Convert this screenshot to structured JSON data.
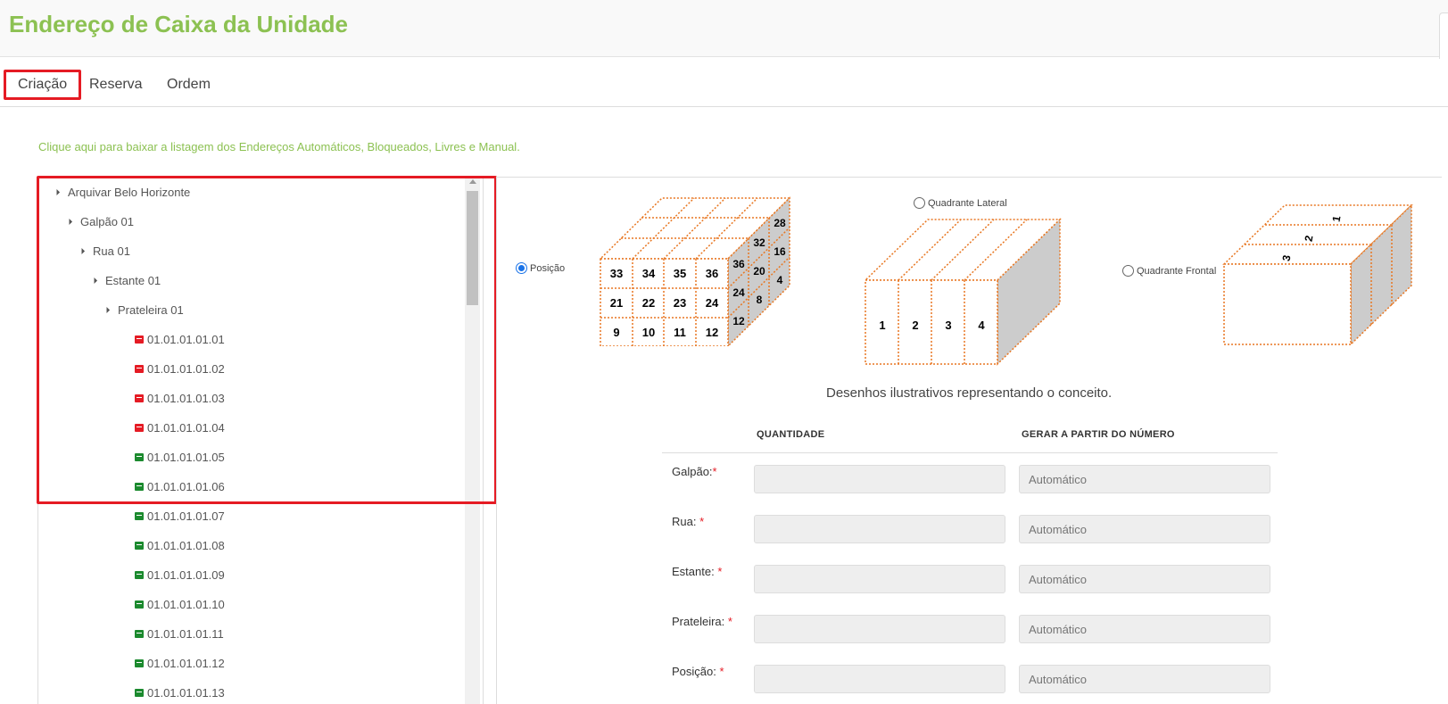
{
  "header": {
    "title": "Endereço de Caixa da Unidade"
  },
  "tabs": [
    {
      "label": "Criação",
      "active": true
    },
    {
      "label": "Reserva",
      "active": false
    },
    {
      "label": "Ordem",
      "active": false
    }
  ],
  "download_link": "Clique aqui para baixar a listagem dos Endereços Automáticos, Bloqueados, Livres e Manual.",
  "tree": {
    "nodes": [
      {
        "label": "Arquivar Belo Horizonte",
        "level": 0,
        "type": "folder"
      },
      {
        "label": "Galpão 01",
        "level": 1,
        "type": "folder"
      },
      {
        "label": "Rua 01",
        "level": 2,
        "type": "folder"
      },
      {
        "label": "Estante 01",
        "level": 3,
        "type": "folder"
      },
      {
        "label": "Prateleira 01",
        "level": 4,
        "type": "folder"
      },
      {
        "label": "01.01.01.01.01",
        "level": 5,
        "type": "box",
        "status": "blocked"
      },
      {
        "label": "01.01.01.01.02",
        "level": 5,
        "type": "box",
        "status": "blocked"
      },
      {
        "label": "01.01.01.01.03",
        "level": 5,
        "type": "box",
        "status": "blocked"
      },
      {
        "label": "01.01.01.01.04",
        "level": 5,
        "type": "box",
        "status": "blocked"
      },
      {
        "label": "01.01.01.01.05",
        "level": 5,
        "type": "box",
        "status": "free"
      },
      {
        "label": "01.01.01.01.06",
        "level": 5,
        "type": "box",
        "status": "free"
      },
      {
        "label": "01.01.01.01.07",
        "level": 5,
        "type": "box",
        "status": "free"
      },
      {
        "label": "01.01.01.01.08",
        "level": 5,
        "type": "box",
        "status": "free"
      },
      {
        "label": "01.01.01.01.09",
        "level": 5,
        "type": "box",
        "status": "free"
      },
      {
        "label": "01.01.01.01.10",
        "level": 5,
        "type": "box",
        "status": "free"
      },
      {
        "label": "01.01.01.01.11",
        "level": 5,
        "type": "box",
        "status": "free"
      },
      {
        "label": "01.01.01.01.12",
        "level": 5,
        "type": "box",
        "status": "free"
      },
      {
        "label": "01.01.01.01.13",
        "level": 5,
        "type": "box",
        "status": "free"
      }
    ]
  },
  "diagram": {
    "options": [
      {
        "label": "Posição",
        "checked": true
      },
      {
        "label": "Quadrante Lateral",
        "checked": false
      },
      {
        "label": "Quadrante Frontal",
        "checked": false
      }
    ],
    "position_front": [
      "33",
      "34",
      "35",
      "36",
      "21",
      "22",
      "23",
      "24",
      "9",
      "10",
      "11",
      "12"
    ],
    "position_side": [
      "28",
      "32",
      "16",
      "36",
      "20",
      "4",
      "24",
      "8",
      "12"
    ],
    "lateral_numbers": [
      "1",
      "2",
      "3",
      "4"
    ],
    "frontal_numbers": [
      "1",
      "2",
      "3"
    ],
    "caption": "Desenhos ilustrativos representando o conceito."
  },
  "form": {
    "col_quantity": "QUANTIDADE",
    "col_start": "GERAR A PARTIR DO NÚMERO",
    "required_mark": "*",
    "rows": [
      {
        "label": "Galpão:",
        "quantity": "",
        "start_placeholder": "Automático"
      },
      {
        "label": "Rua: ",
        "quantity": "",
        "start_placeholder": "Automático"
      },
      {
        "label": "Estante: ",
        "quantity": "",
        "start_placeholder": "Automático"
      },
      {
        "label": "Prateleira: ",
        "quantity": "",
        "start_placeholder": "Automático"
      },
      {
        "label": "Posição: ",
        "quantity": "",
        "start_placeholder": "Automático"
      }
    ]
  },
  "colors": {
    "brand_green": "#8cc152",
    "highlight_red": "#e51b24",
    "blocked_red": "#e51b24",
    "free_green": "#1b8a2e",
    "diagram_orange": "#e87722",
    "diagram_gray": "#cccccc"
  }
}
